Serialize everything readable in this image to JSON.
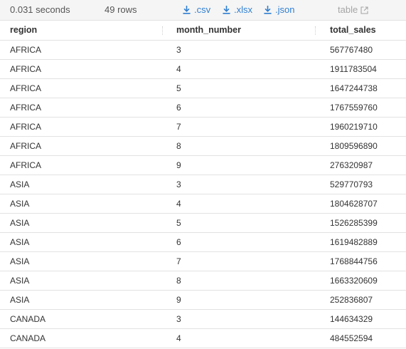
{
  "toolbar": {
    "time": "0.031 seconds",
    "rows": "49 rows",
    "csv_label": ".csv",
    "xlsx_label": ".xlsx",
    "json_label": ".json",
    "table_label": "table",
    "icons": {
      "download": "download-icon",
      "external": "external-link-icon"
    },
    "link_color": "#2f7fd1"
  },
  "table": {
    "columns": [
      "region",
      "month_number",
      "total_sales"
    ],
    "rows": [
      [
        "AFRICA",
        "3",
        "567767480"
      ],
      [
        "AFRICA",
        "4",
        "1911783504"
      ],
      [
        "AFRICA",
        "5",
        "1647244738"
      ],
      [
        "AFRICA",
        "6",
        "1767559760"
      ],
      [
        "AFRICA",
        "7",
        "1960219710"
      ],
      [
        "AFRICA",
        "8",
        "1809596890"
      ],
      [
        "AFRICA",
        "9",
        "276320987"
      ],
      [
        "ASIA",
        "3",
        "529770793"
      ],
      [
        "ASIA",
        "4",
        "1804628707"
      ],
      [
        "ASIA",
        "5",
        "1526285399"
      ],
      [
        "ASIA",
        "6",
        "1619482889"
      ],
      [
        "ASIA",
        "7",
        "1768844756"
      ],
      [
        "ASIA",
        "8",
        "1663320609"
      ],
      [
        "ASIA",
        "9",
        "252836807"
      ],
      [
        "CANADA",
        "3",
        "144634329"
      ],
      [
        "CANADA",
        "4",
        "484552594"
      ]
    ]
  }
}
